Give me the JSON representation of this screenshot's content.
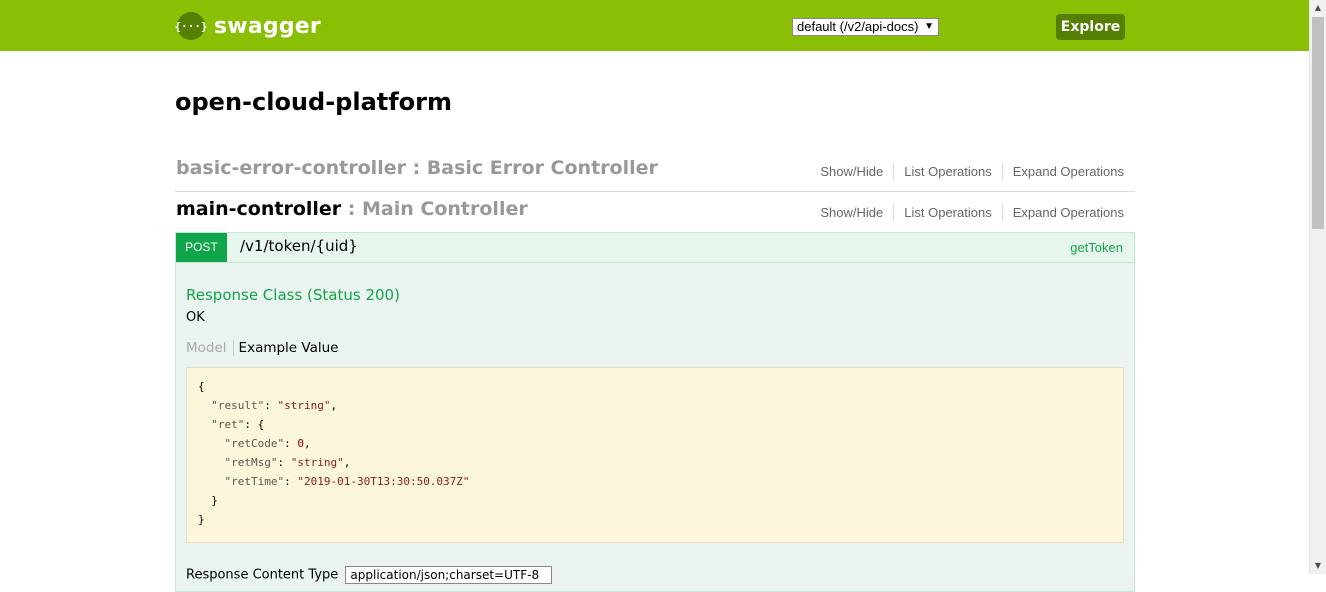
{
  "header": {
    "logo_text": "swagger",
    "logo_glyph": "{···}",
    "spec_select_value": "default (/v2/api-docs)",
    "explore_label": "Explore",
    "bg_color": "#89bf04"
  },
  "api_title": "open-cloud-platform",
  "resources": [
    {
      "name": "basic-error-controller",
      "separator": " : ",
      "description": "Basic Error Controller",
      "ops": {
        "show_hide": "Show/Hide",
        "list": "List Operations",
        "expand": "Expand Operations"
      }
    },
    {
      "name": "main-controller",
      "separator": " : ",
      "description": "Main Controller",
      "ops": {
        "show_hide": "Show/Hide",
        "list": "List Operations",
        "expand": "Expand Operations"
      }
    }
  ],
  "operation": {
    "method": "POST",
    "path": "/v1/token/{uid}",
    "nickname": "getToken",
    "response_class_title": "Response Class (Status 200)",
    "response_message": "OK",
    "tabs": {
      "model": "Model",
      "example": "Example Value"
    },
    "example": {
      "result_key": "\"result\"",
      "result_val": "\"string\"",
      "ret_key": "\"ret\"",
      "retCode_key": "\"retCode\"",
      "retCode_val": "0",
      "retMsg_key": "\"retMsg\"",
      "retMsg_val": "\"string\"",
      "retTime_key": "\"retTime\"",
      "retTime_val": "\"2019-01-30T13:30:50.037Z\""
    },
    "content_type_label": "Response Content Type",
    "content_type_value": "application/json;charset=UTF-8"
  }
}
